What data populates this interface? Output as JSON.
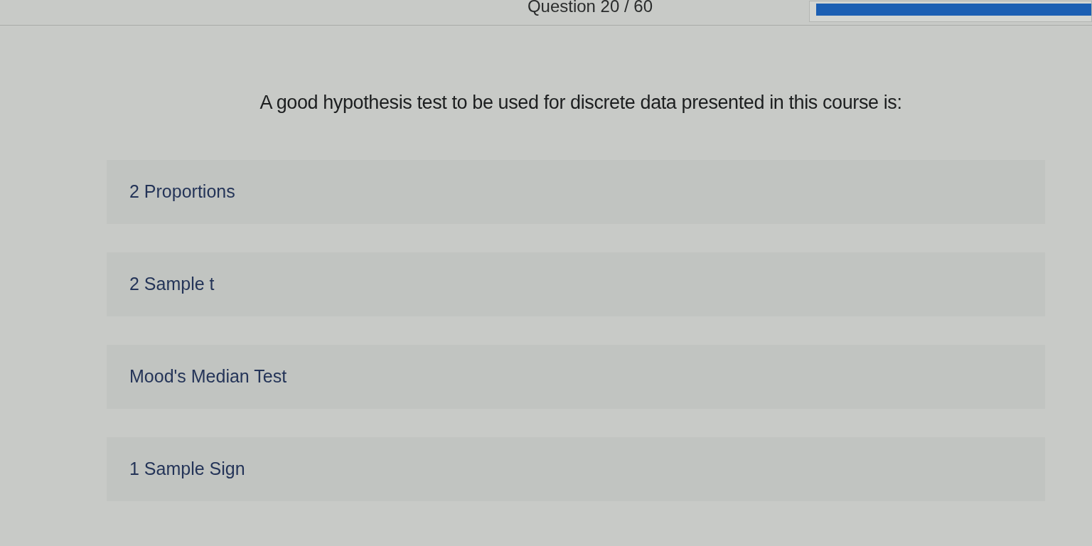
{
  "header": {
    "counter": "Question 20 / 60",
    "progress": {
      "level": 1
    }
  },
  "question": {
    "text": "A good hypothesis test to be used for discrete data presented in this course is:"
  },
  "options": [
    {
      "label": "2 Proportions",
      "selected": false
    },
    {
      "label": "2 Sample t",
      "selected": false
    },
    {
      "label": "Mood's Median Test",
      "selected": false
    },
    {
      "label": "1 Sample Sign",
      "selected": false
    }
  ]
}
